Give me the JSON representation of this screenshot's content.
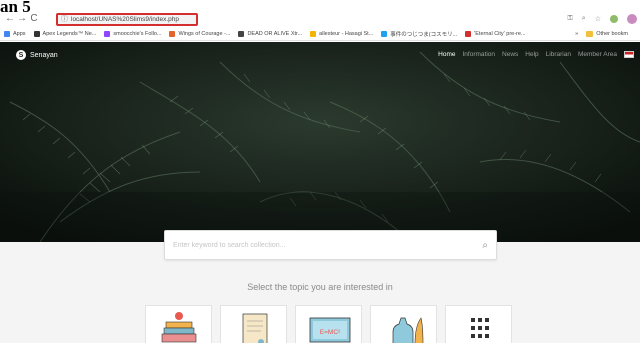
{
  "fragment": "an 5",
  "browser": {
    "nav": {
      "back": "←",
      "forward": "→",
      "reload": "C"
    },
    "address": {
      "icon": "info-icon",
      "url": "localhost/UNAS%20Slims9/index.php"
    },
    "toolbar_icons": [
      "key-icon",
      "zoom-icon",
      "star-icon",
      "extension-icon",
      "profile-avatar"
    ],
    "bookmarks": [
      {
        "label": "Apps",
        "icon": "apps-grid-icon",
        "color": "#4285f4"
      },
      {
        "label": "Apex Legends™ Ne...",
        "icon": "apex-icon",
        "color": "#333333"
      },
      {
        "label": "smoocchie's Follo...",
        "icon": "twitch-icon",
        "color": "#9146ff"
      },
      {
        "label": "Wings of Courage -...",
        "icon": "wings-icon",
        "color": "#e4632b"
      },
      {
        "label": "DEAD OR ALIVE Xtr...",
        "icon": "doa-icon",
        "color": "#444444"
      },
      {
        "label": "allesteur - Hasagi St...",
        "icon": "hasagi-icon",
        "color": "#f4b400"
      },
      {
        "label": "事件のつじつま(コスモリ...",
        "icon": "twitter-icon",
        "color": "#1da1f2"
      },
      {
        "label": "'Eternal City' pre-re...",
        "icon": "eternal-icon",
        "color": "#d32f2f"
      }
    ],
    "bookmarks_overflow": "»",
    "other_bookmarks": "Other bookm"
  },
  "site": {
    "brand": "Senayan",
    "brand_logo": "S",
    "nav": [
      {
        "label": "Home",
        "active": true
      },
      {
        "label": "Information",
        "active": false
      },
      {
        "label": "News",
        "active": false
      },
      {
        "label": "Help",
        "active": false
      },
      {
        "label": "Librarian",
        "active": false
      },
      {
        "label": "Member Area",
        "active": false
      }
    ],
    "lang_icon": "flag-icon",
    "search": {
      "placeholder": "Enter keyword to search collection..."
    },
    "topic_title": "Select the topic you are interested in",
    "topics": [
      {
        "icon": "books-apple-icon"
      },
      {
        "icon": "scroll-icon"
      },
      {
        "icon": "board-formula-icon",
        "label": "E=MC²"
      },
      {
        "icon": "flask-icon"
      },
      {
        "icon": "grid-more-icon"
      }
    ]
  }
}
